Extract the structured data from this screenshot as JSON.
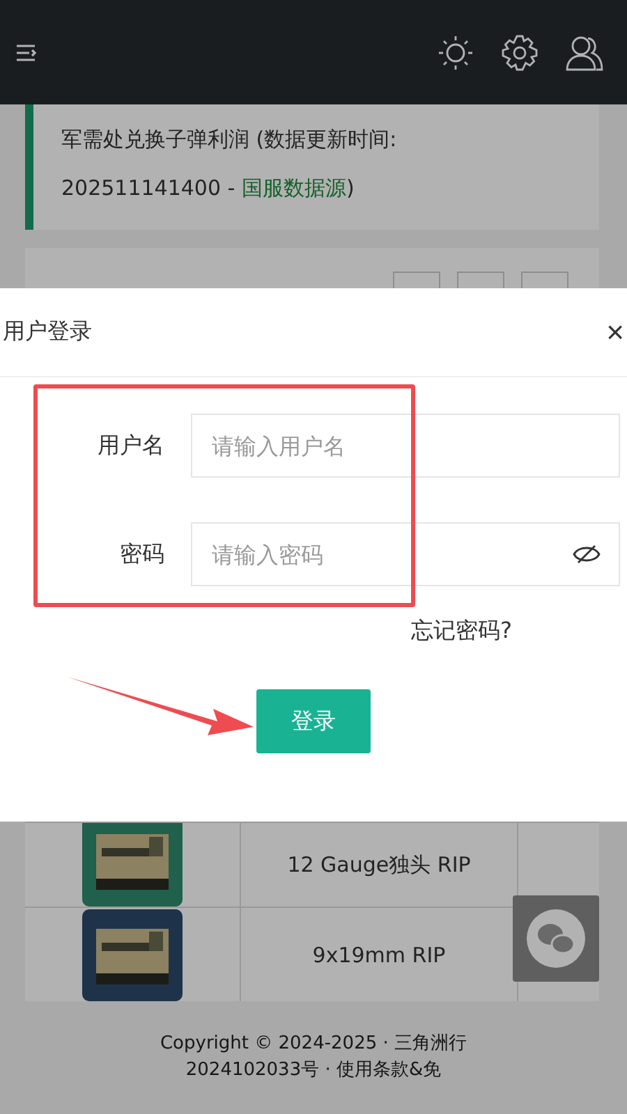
{
  "notice": {
    "text": "军需处兑换子弹利润 (数据更新时间: 202511141400 - ",
    "link": "国服数据源",
    "suffix": ")"
  },
  "rows": [
    {
      "name": "12 Gauge独头 RIP"
    },
    {
      "name": "9x19mm RIP"
    }
  ],
  "footer": {
    "lines": [
      "Copyright © 2024-2025 · 三角洲行",
      "2024102033号 · 使用条款&免"
    ]
  },
  "dialog": {
    "title": "用户登录",
    "close": "×",
    "fields": [
      {
        "label": "用户名",
        "placeholder": "请输入用户名",
        "kind": "text"
      },
      {
        "label": "密码",
        "placeholder": "请输入密码",
        "kind": "password"
      }
    ],
    "forgot": "忘记密码?",
    "submit": "登录"
  }
}
